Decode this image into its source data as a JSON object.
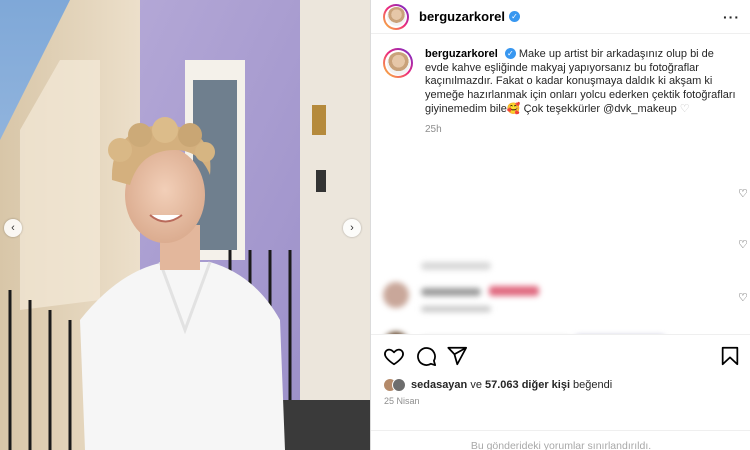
{
  "post": {
    "username": "berguzarkorel",
    "verified_icon": "verified-badge-icon",
    "more_icon": "more-options-icon"
  },
  "caption": {
    "username": "berguzarkorel",
    "text": "Make up artist bir arkadaşınız olup bi de evde kahve eşliğinde makyaj yapıyorsanız bu fotoğraflar kaçınılmazdır. Fakat o kadar konuşmaya daldık ki akşam ki yemeğe hazırlanmak için onları yolcu ederken çektik fotoğrafları giyinemedim bile🥰 Çok teşekkürler @dvk_makeup",
    "time": "25h"
  },
  "actions": {
    "like_icon": "heart-icon",
    "comment_icon": "comment-icon",
    "share_icon": "send-icon",
    "save_icon": "bookmark-icon"
  },
  "likes": {
    "first_user": "sedasayan",
    "connector": " ve ",
    "others": "57.063 diğer kişi",
    "suffix": " beğendi"
  },
  "date": "25 Nisan",
  "comments_limited": "Bu gönderideki yorumlar sınırlandırıldı.",
  "nav": {
    "prev": "‹",
    "next": "›"
  },
  "colors": {
    "accent": "#3897f0",
    "muted": "#8e8e8e"
  }
}
